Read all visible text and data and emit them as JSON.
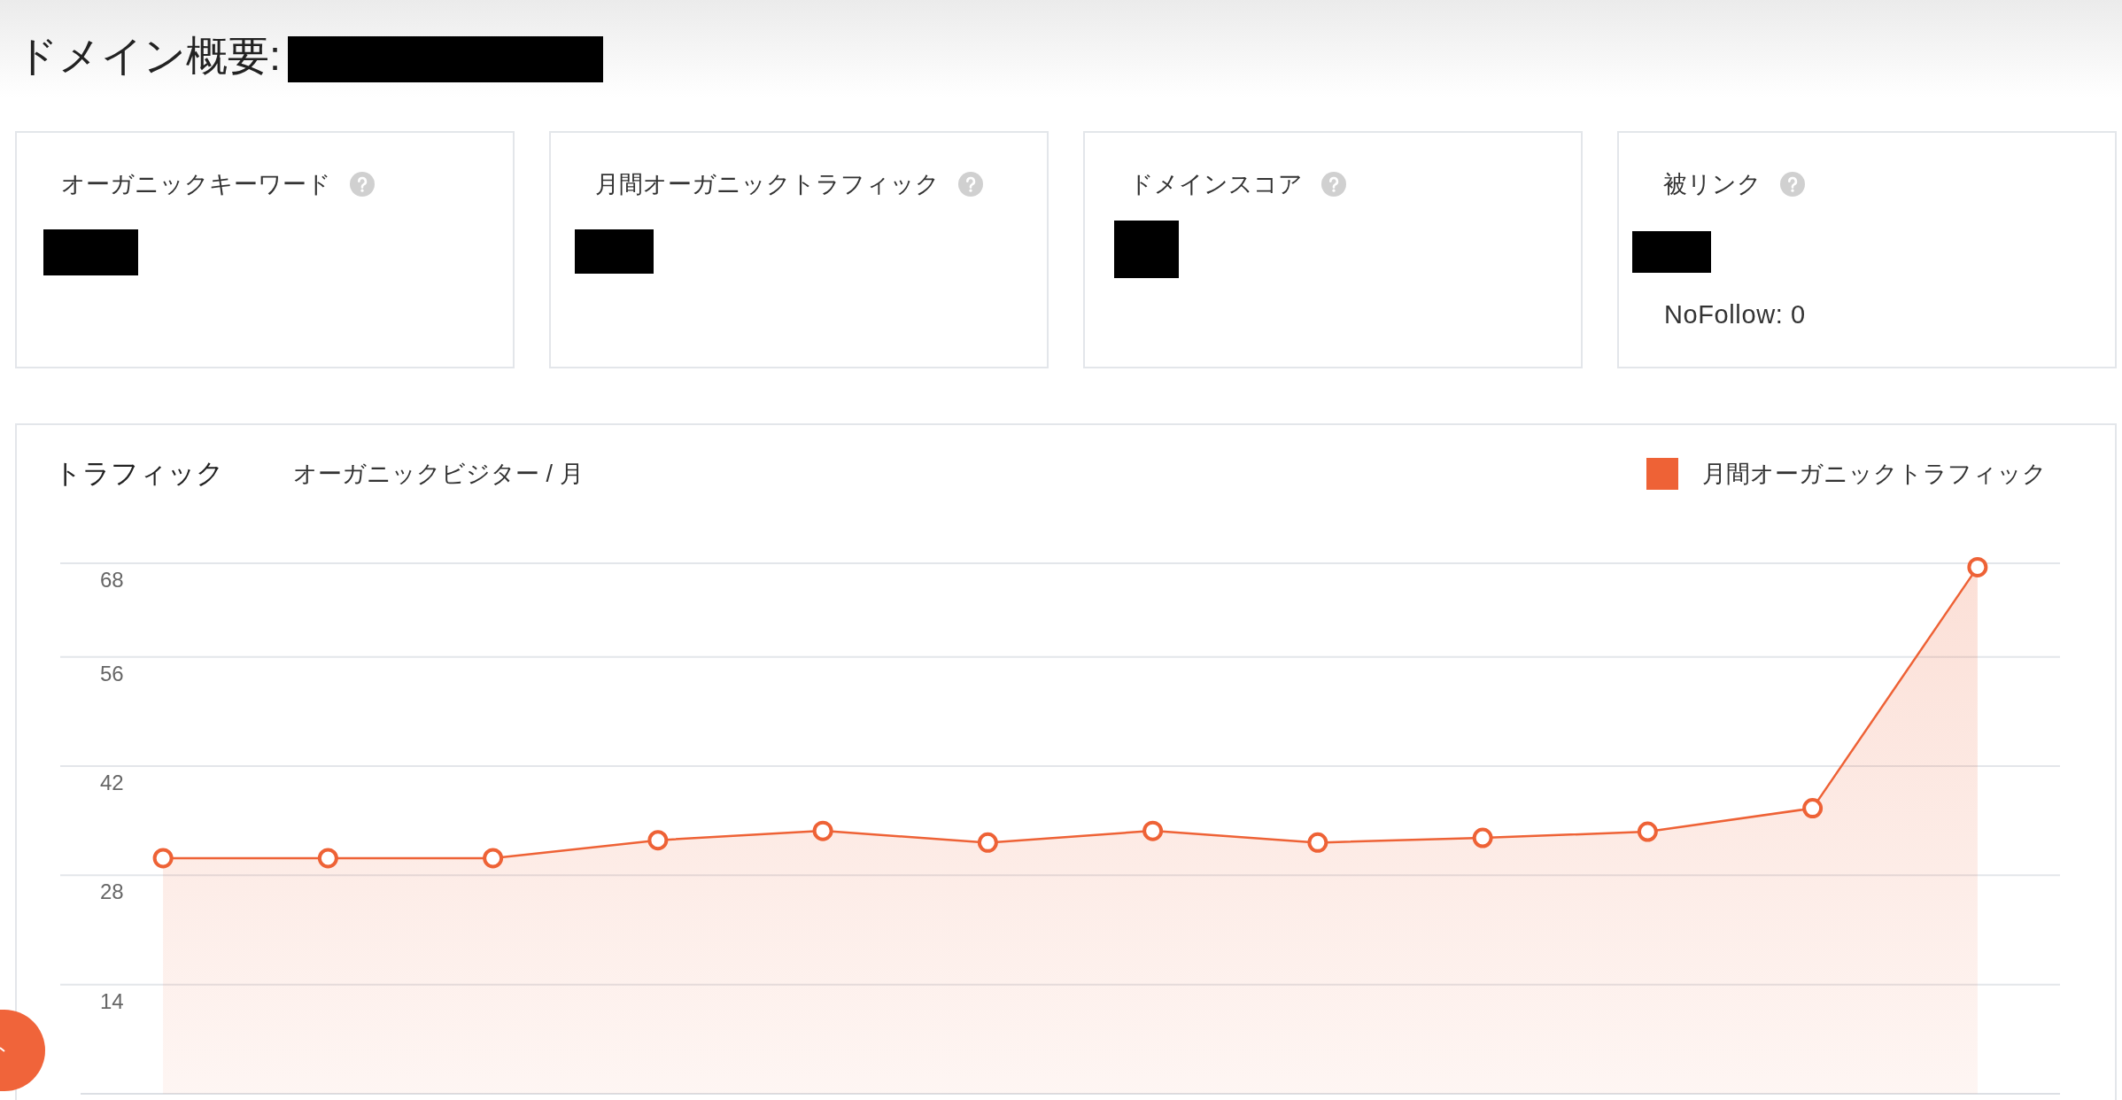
{
  "page_title": "ドメイン概要:",
  "metric_cards": [
    {
      "label": "オーガニックキーワード"
    },
    {
      "label": "月間オーガニックトラフィック"
    },
    {
      "label": "ドメインスコア"
    },
    {
      "label": "被リンク",
      "note": "NoFollow: 0"
    }
  ],
  "traffic_card": {
    "title": "トラフィック",
    "subtitle": "オーガニックビジター / 月",
    "chart_data": {
      "type": "area",
      "grid": true,
      "ylim": [
        0,
        68
      ],
      "yticks": [
        14,
        28,
        42,
        56,
        68
      ],
      "series": [
        {
          "name": "月間オーガニックトラフィック",
          "color": "#ee6236",
          "values": [
            30.2,
            30.2,
            30.2,
            32.5,
            33.7,
            32.2,
            33.7,
            32.2,
            32.8,
            33.6,
            36.6,
            67.5
          ]
        }
      ]
    }
  }
}
